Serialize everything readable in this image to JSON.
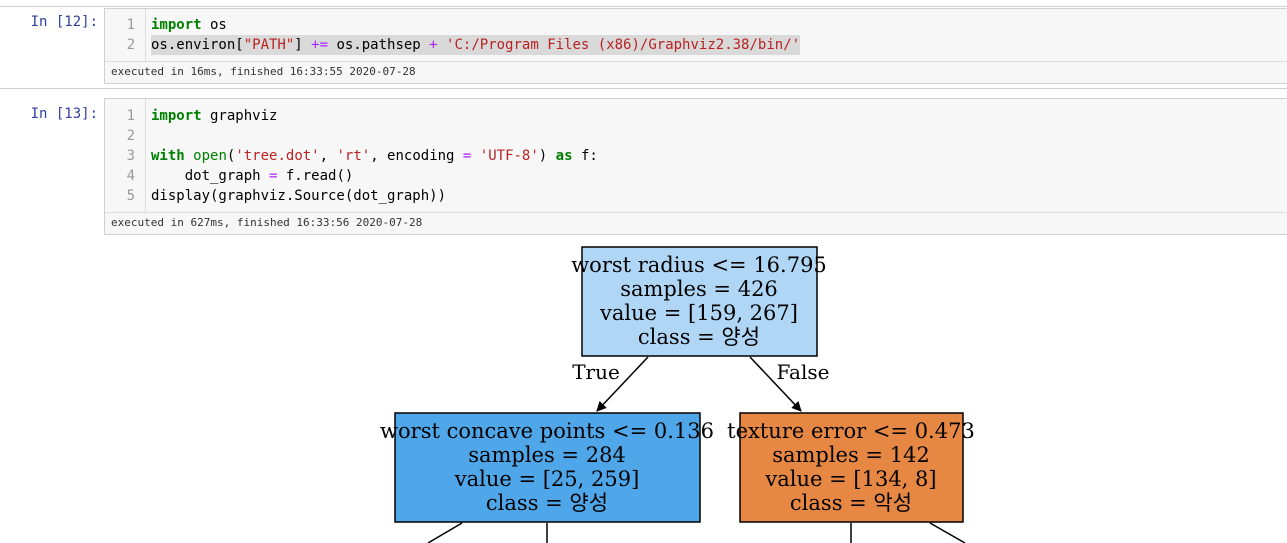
{
  "cells": [
    {
      "prompt": "In [12]:",
      "line_numbers": [
        "1",
        "2"
      ],
      "line1": {
        "kw_import": "import",
        "module": " os"
      },
      "line2": {
        "pre": "os.environ[",
        "str1": "\"PATH\"",
        "mid1": "] ",
        "op1": "+=",
        "mid2": " os.pathsep ",
        "op2": "+",
        "mid3": " ",
        "str2": "'C:/Program Files (x86)/Graphviz2.38/bin/'"
      },
      "exec_info": "executed in 16ms, finished 16:33:55 2020-07-28"
    },
    {
      "prompt": "In [13]:",
      "line_numbers": [
        "1",
        "2",
        "3",
        "4",
        "5"
      ],
      "line1": {
        "kw_import": "import",
        "module": " graphviz"
      },
      "line3": {
        "kw_with": "with",
        "sp1": " ",
        "fn_open": "open",
        "p1": "(",
        "str1": "'tree.dot'",
        "c1": ", ",
        "str2": "'rt'",
        "c2": ", encoding ",
        "op": "=",
        "sp2": " ",
        "str3": "'UTF-8'",
        "p2": ") ",
        "kw_as": "as",
        "tail": " f:"
      },
      "line4": {
        "pre": "    dot_graph ",
        "op": "=",
        "tail": " f.read()"
      },
      "line5": {
        "text": "display(graphviz.Source(dot_graph))"
      },
      "exec_info": "executed in 627ms, finished 16:33:56 2020-07-28"
    }
  ],
  "tree": {
    "root": {
      "lines": [
        "worst radius <= 16.795",
        "samples = 426",
        "value = [159, 267]",
        "class = 양성"
      ],
      "fill": "#b0d6f5"
    },
    "left": {
      "lines": [
        "worst concave points <= 0.136",
        "samples = 284",
        "value = [25, 259]",
        "class = 양성"
      ],
      "fill": "#4fa6e8"
    },
    "right": {
      "lines": [
        "texture error <= 0.473",
        "samples = 142",
        "value = [134, 8]",
        "class = 악성"
      ],
      "fill": "#e68844"
    },
    "edge_true": "True",
    "edge_false": "False"
  }
}
